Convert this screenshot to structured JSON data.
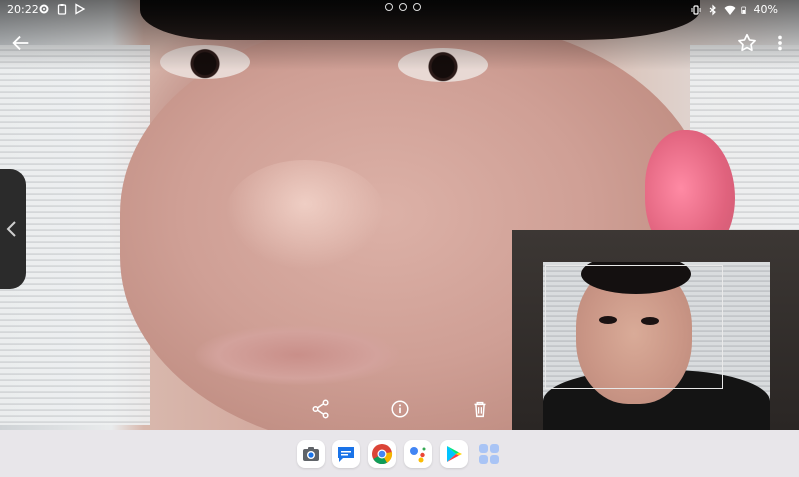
{
  "status_bar": {
    "time": "20:22",
    "battery": "40%"
  },
  "colors": {
    "dock_background": "#e8e6ea",
    "side_tab": "#2b2b2b",
    "icon_white": "#ffffff"
  },
  "icons": {
    "back": "back-arrow-icon",
    "favorite": "star-outline-icon",
    "more": "more-vertical-icon",
    "share": "share-icon",
    "info": "info-icon",
    "delete": "trash-icon",
    "side_panel": "chevron-left-icon"
  },
  "dock_apps": [
    "camera",
    "messages",
    "chrome",
    "assistant",
    "play-store",
    "app-drawer"
  ]
}
